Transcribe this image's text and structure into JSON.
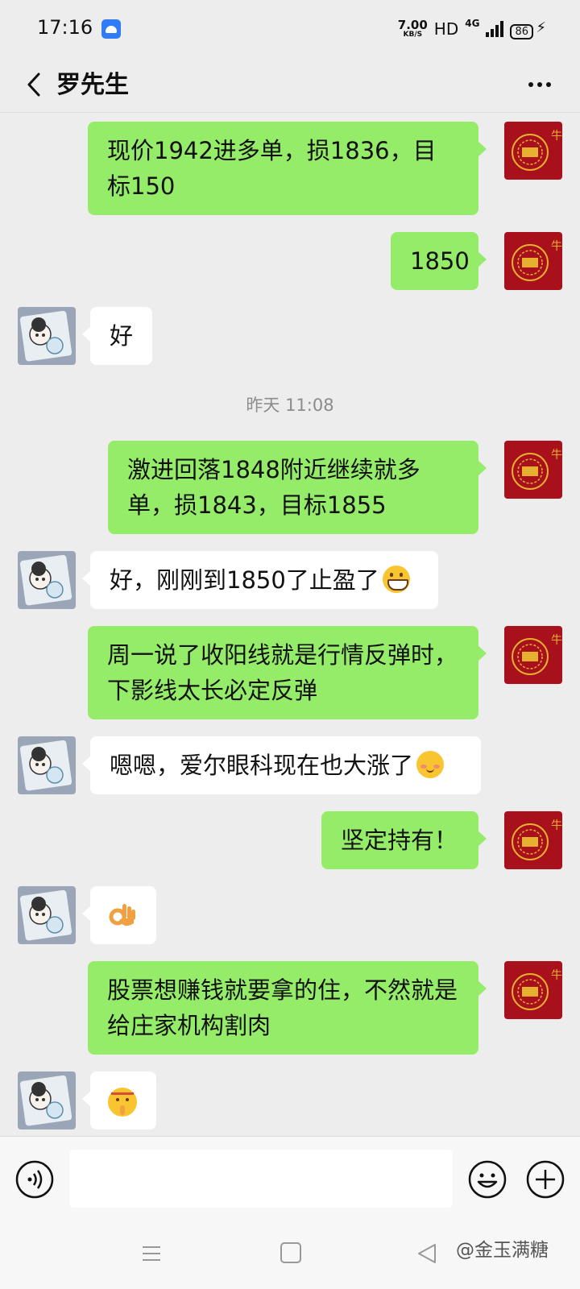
{
  "status_bar": {
    "time": "17:16",
    "speed_value": "7.00",
    "speed_unit": "KB/S",
    "hd": "HD",
    "network": "4G",
    "battery": "86"
  },
  "header": {
    "title": "罗先生"
  },
  "messages": [
    {
      "sender": "me",
      "text": "现价1942进多单，损1836，目标150"
    },
    {
      "sender": "me",
      "text": "1850"
    },
    {
      "sender": "contact",
      "text": "好"
    },
    {
      "type": "time",
      "text": "昨天 11:08"
    },
    {
      "sender": "me",
      "text": "激进回落1848附近继续就多单，损1843，目标1855"
    },
    {
      "sender": "contact",
      "text": "好，刚刚到1850了止盈了",
      "emoji": "grin"
    },
    {
      "sender": "me",
      "text": "周一说了收阳线就是行情反弹时，下影线太长必定反弹"
    },
    {
      "sender": "contact",
      "text": "嗯嗯，爱尔眼科现在也大涨了",
      "emoji": "shy"
    },
    {
      "sender": "me",
      "text": "坚定持有！"
    },
    {
      "sender": "contact",
      "sticker": "ok-hand"
    },
    {
      "sender": "me",
      "text": "股票想赚钱就要拿的住，不然就是给庄家机构割肉"
    },
    {
      "sender": "contact",
      "sticker": "shush-face"
    }
  ],
  "input": {
    "value": "",
    "placeholder": ""
  },
  "watermark": "@金玉满糖",
  "colors": {
    "background": "#ededed",
    "my_bubble": "#95ec69",
    "contact_bubble": "#ffffff",
    "avatar_red": "#a8101c"
  }
}
